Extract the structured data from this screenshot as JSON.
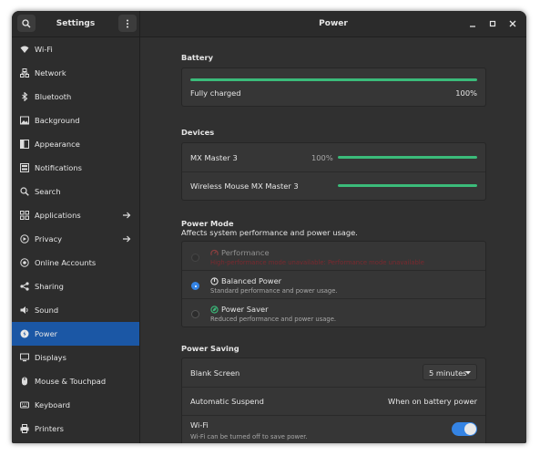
{
  "window": {
    "sidebar_title": "Settings",
    "title": "Power"
  },
  "sidebar": {
    "items": [
      {
        "label": "Wi-Fi",
        "icon": "wifi-icon"
      },
      {
        "label": "Network",
        "icon": "network-icon"
      },
      {
        "label": "Bluetooth",
        "icon": "bluetooth-icon"
      },
      {
        "label": "Background",
        "icon": "background-icon"
      },
      {
        "label": "Appearance",
        "icon": "appearance-icon"
      },
      {
        "label": "Notifications",
        "icon": "notifications-icon"
      },
      {
        "label": "Search",
        "icon": "search-icon"
      },
      {
        "label": "Applications",
        "icon": "applications-icon",
        "has_arrow": true
      },
      {
        "label": "Privacy",
        "icon": "privacy-icon",
        "has_arrow": true
      },
      {
        "label": "Online Accounts",
        "icon": "online-accounts-icon"
      },
      {
        "label": "Sharing",
        "icon": "sharing-icon"
      },
      {
        "label": "Sound",
        "icon": "sound-icon"
      },
      {
        "label": "Power",
        "icon": "power-icon",
        "active": true
      },
      {
        "label": "Displays",
        "icon": "displays-icon"
      },
      {
        "label": "Mouse & Touchpad",
        "icon": "mouse-icon"
      },
      {
        "label": "Keyboard",
        "icon": "keyboard-icon"
      },
      {
        "label": "Printers",
        "icon": "printers-icon"
      }
    ]
  },
  "battery": {
    "title": "Battery",
    "status": "Fully charged",
    "percent": "100%",
    "level": 1.0
  },
  "devices": {
    "title": "Devices",
    "items": [
      {
        "name": "MX Master 3",
        "percent": "100%",
        "level": 1.0
      },
      {
        "name": "Wireless Mouse MX Master 3",
        "percent": "",
        "level": 1.0
      }
    ]
  },
  "power_mode": {
    "title": "Power Mode",
    "subtitle": "Affects system performance and power usage.",
    "options": [
      {
        "label": "Performance",
        "description": "High-performance mode unavailable: Performance mode unavailable",
        "selected": false,
        "disabled": true,
        "icon": "performance-icon"
      },
      {
        "label": "Balanced Power",
        "description": "Standard performance and power usage.",
        "selected": true,
        "disabled": false,
        "icon": "balanced-icon"
      },
      {
        "label": "Power Saver",
        "description": "Reduced performance and power usage.",
        "selected": false,
        "disabled": false,
        "icon": "power-saver-icon"
      }
    ]
  },
  "power_saving": {
    "title": "Power Saving",
    "blank_screen_label": "Blank Screen",
    "blank_screen_value": "5 minutes",
    "auto_suspend_label": "Automatic Suspend",
    "auto_suspend_value": "When on battery power",
    "wifi_label": "Wi-Fi",
    "wifi_description": "Wi-Fi can be turned off to save power.",
    "wifi_enabled": true
  },
  "colors": {
    "accent": "#3584e4",
    "active_item": "#1b57a5",
    "battery_fill": "#3bbb7a",
    "warning": "#c01c28"
  }
}
